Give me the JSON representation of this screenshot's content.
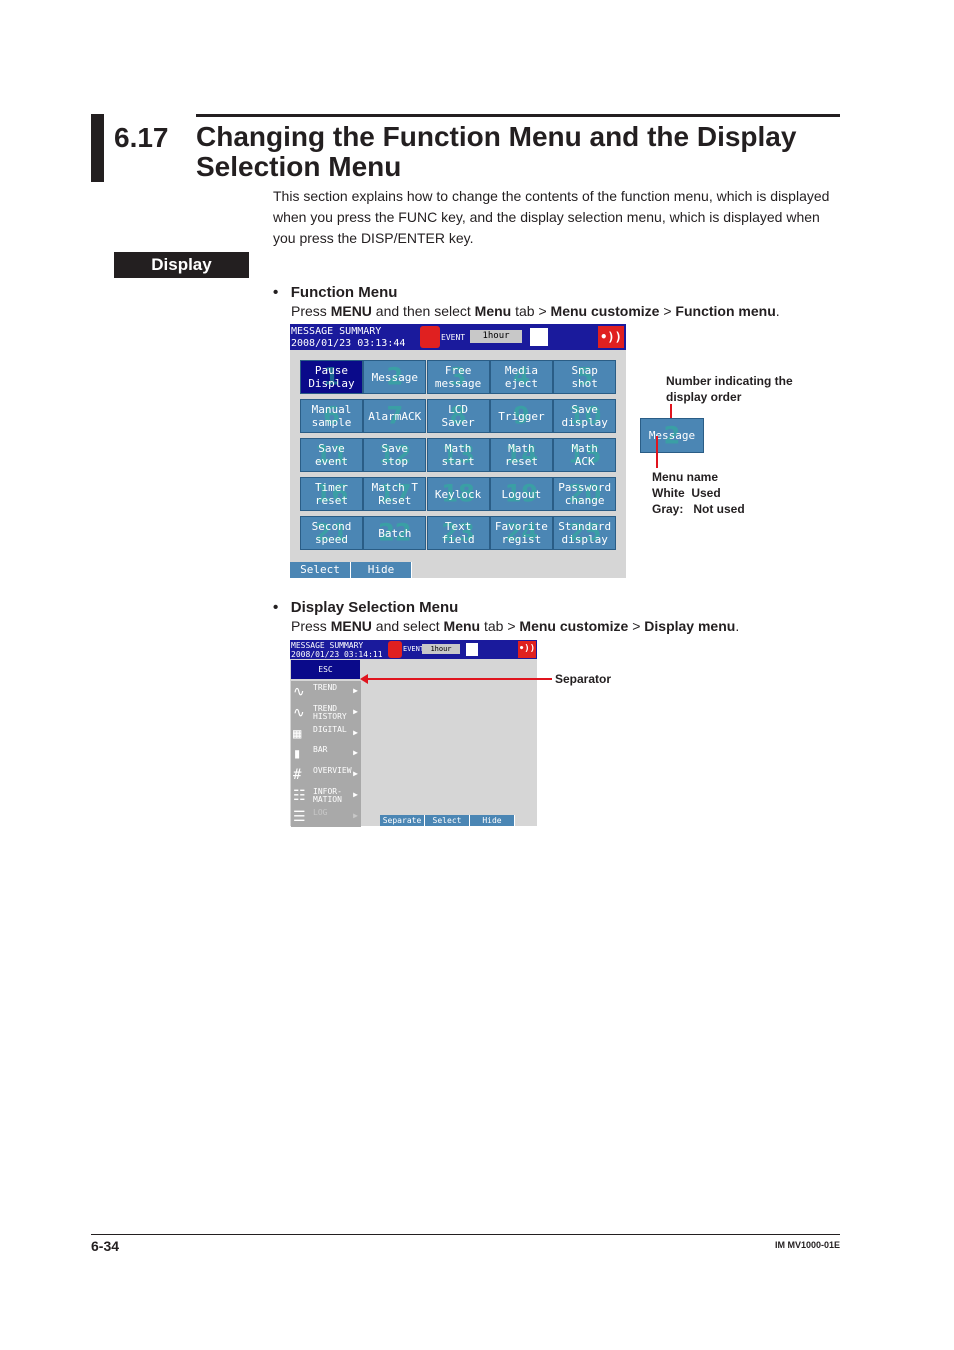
{
  "header": {
    "section_number": "6.17",
    "title": "Changing the Function Menu and the Display Selection Menu",
    "intro": "This section explains how to change the contents of the function menu, which is displayed when you press the FUNC key, and the display selection menu, which is displayed when you press the DISP/ENTER key."
  },
  "display_label": "Display",
  "function_menu": {
    "bullet": "Function Menu",
    "instruction": {
      "p1": "Press ",
      "b1": "MENU",
      "p2": " and then select ",
      "b2": "Menu",
      "p3": " tab > ",
      "b3": "Menu customize",
      "p4": " > ",
      "b4": "Function menu",
      "p5": "."
    },
    "screen": {
      "title": "MESSAGE SUMMARY",
      "datetime": "2008/01/23 03:13:44",
      "event_label": "EVENT",
      "interval": "1hour",
      "buttons": [
        {
          "label": "Pause\nDisplay",
          "num": "1",
          "selected": true
        },
        {
          "label": "Message",
          "num": "2"
        },
        {
          "label": "Free\nmessage",
          "num": "3"
        },
        {
          "label": "Media\neject",
          "num": "4"
        },
        {
          "label": "Snap\nshot",
          "num": "5"
        },
        {
          "label": "Manual\nsample",
          "num": "6"
        },
        {
          "label": "AlarmACK",
          "num": "7"
        },
        {
          "label": "LCD\nSaver",
          "num": "8"
        },
        {
          "label": "Trigger",
          "num": "9"
        },
        {
          "label": "Save\ndisplay",
          "num": "10"
        },
        {
          "label": "Save\nevent",
          "num": "11"
        },
        {
          "label": "Save\nstop",
          "num": "12"
        },
        {
          "label": "Math\nstart",
          "num": "13"
        },
        {
          "label": "Math\nreset",
          "num": "14"
        },
        {
          "label": "Math\nACK",
          "num": "15"
        },
        {
          "label": "Timer\nreset",
          "num": "16"
        },
        {
          "label": "Match T\nReset",
          "num": "17"
        },
        {
          "label": "Keylock",
          "num": "18"
        },
        {
          "label": "Logout",
          "num": "19"
        },
        {
          "label": "Password\nchange",
          "num": "20"
        },
        {
          "label": "Second\nspeed",
          "num": "21"
        },
        {
          "label": "Batch",
          "num": "22"
        },
        {
          "label": "Text\nfield",
          "num": "23"
        },
        {
          "label": "Favorite\nregist",
          "num": "24"
        },
        {
          "label": "Standard\ndisplay",
          "num": "25"
        }
      ],
      "softkeys": [
        "Select",
        "Hide"
      ]
    },
    "callout": {
      "number_note": "Number indicating the display order",
      "sample_label": "Message",
      "sample_num": "2",
      "name_note": [
        "Menu name",
        "White  Used",
        "Gray:   Not used"
      ]
    }
  },
  "display_menu": {
    "bullet": "Display Selection Menu",
    "instruction": {
      "p1": "Press ",
      "b1": "MENU",
      "p2": " and select ",
      "b2": "Menu",
      "p3": " tab > ",
      "b3": "Menu customize",
      "p4": " > ",
      "b4": "Display menu",
      "p5": "."
    },
    "screen": {
      "title": "MESSAGE SUMMARY",
      "datetime": "2008/01/23 03:14:11",
      "event_label": "EVENT",
      "interval": "1hour",
      "esc": "ESC",
      "items": [
        {
          "label": "TREND",
          "icon": "trend-icon",
          "used": true
        },
        {
          "label": "TREND\nHISTORY",
          "icon": "trend-history-icon",
          "used": true
        },
        {
          "label": "DIGITAL",
          "icon": "digital-icon",
          "used": true
        },
        {
          "label": "BAR",
          "icon": "bar-chart-icon",
          "used": true
        },
        {
          "label": "OVERVIEW",
          "icon": "overview-icon",
          "used": true
        },
        {
          "label": "INFOR-\nMATION",
          "icon": "information-icon",
          "used": true
        },
        {
          "label": "LOG",
          "icon": "log-icon",
          "used": false
        }
      ],
      "softkeys": [
        "Separate",
        "Select",
        "Hide"
      ]
    },
    "separator_note": "Separator"
  },
  "footer": {
    "page": "6-34",
    "doc_id": "IM MV1000-01E"
  }
}
